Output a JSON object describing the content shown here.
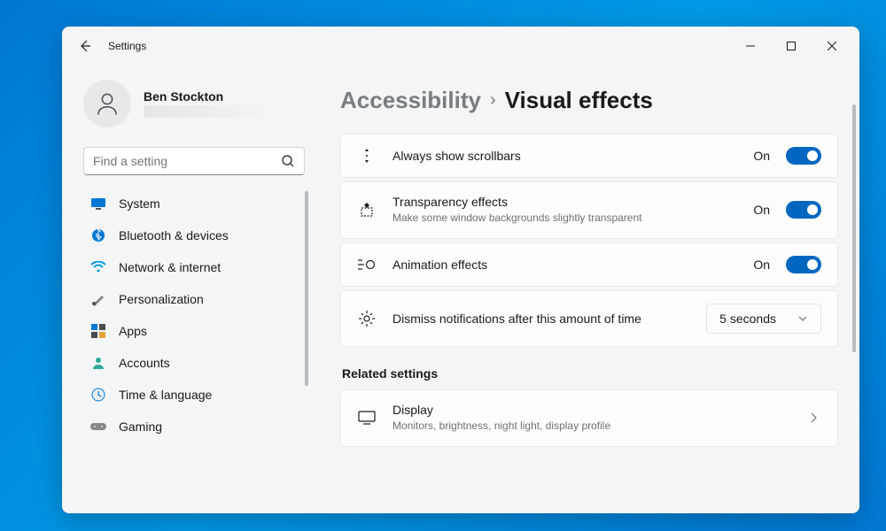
{
  "window": {
    "title": "Settings"
  },
  "user": {
    "name": "Ben Stockton"
  },
  "search": {
    "placeholder": "Find a setting"
  },
  "nav": [
    {
      "label": "System",
      "icon": "system-icon"
    },
    {
      "label": "Bluetooth & devices",
      "icon": "bluetooth-icon"
    },
    {
      "label": "Network & internet",
      "icon": "wifi-icon"
    },
    {
      "label": "Personalization",
      "icon": "brush-icon"
    },
    {
      "label": "Apps",
      "icon": "apps-icon"
    },
    {
      "label": "Accounts",
      "icon": "accounts-icon"
    },
    {
      "label": "Time & language",
      "icon": "clock-icon"
    },
    {
      "label": "Gaming",
      "icon": "gaming-icon"
    }
  ],
  "breadcrumb": {
    "parent": "Accessibility",
    "current": "Visual effects"
  },
  "settings": [
    {
      "title": "Always show scrollbars",
      "state": "On",
      "on": true
    },
    {
      "title": "Transparency effects",
      "subtitle": "Make some window backgrounds slightly transparent",
      "state": "On",
      "on": true
    },
    {
      "title": "Animation effects",
      "state": "On",
      "on": true
    },
    {
      "title": "Dismiss notifications after this amount of time",
      "value": "5 seconds"
    }
  ],
  "related": {
    "heading": "Related settings",
    "items": [
      {
        "title": "Display",
        "subtitle": "Monitors, brightness, night light, display profile"
      }
    ]
  },
  "colors": {
    "accent": "#0067c0",
    "bgWindow": "#f3f5f6",
    "card": "#fdfdfd",
    "textPrimary": "#1a1a1a",
    "textSecondary": "#6e7174"
  }
}
